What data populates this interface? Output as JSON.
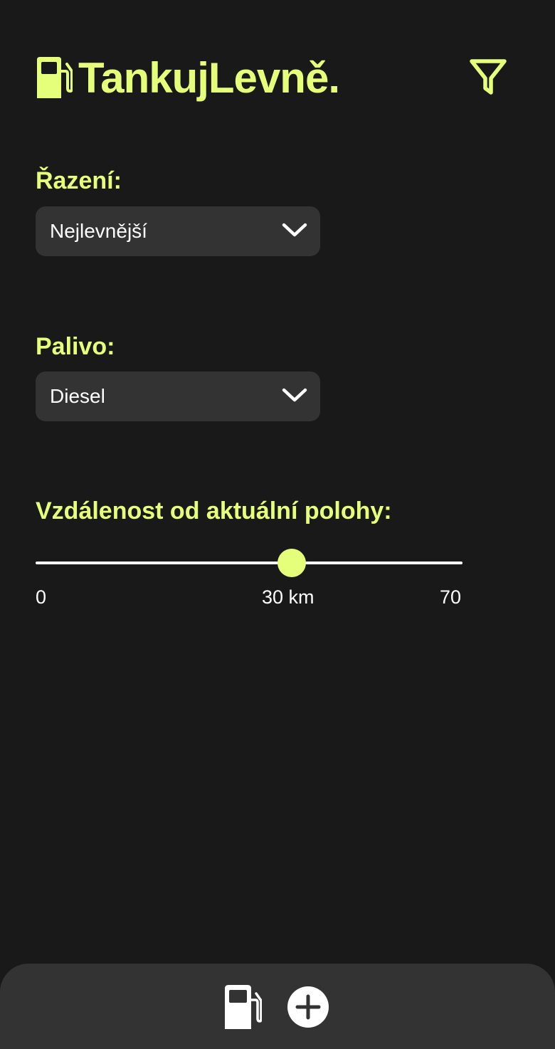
{
  "header": {
    "app_title": "TankujLevně.",
    "logo_icon": "fuel-pump-icon",
    "filter_icon": "filter-icon"
  },
  "filters": {
    "sort": {
      "label": "Řazení:",
      "selected": "Nejlevnější"
    },
    "fuel": {
      "label": "Palivo:",
      "selected": "Diesel"
    },
    "distance": {
      "label": "Vzdálenost od aktuální polohy:",
      "min_label": "0",
      "value_label": "30 km",
      "max_label": "70",
      "value_fraction": 0.6
    }
  },
  "bottom_nav": {
    "items": [
      {
        "icon": "fuel-pump-icon"
      },
      {
        "icon": "plus-icon"
      }
    ]
  },
  "colors": {
    "accent": "#e6ff7a",
    "background": "#191919",
    "surface": "#333333",
    "text": "#ffffff"
  }
}
